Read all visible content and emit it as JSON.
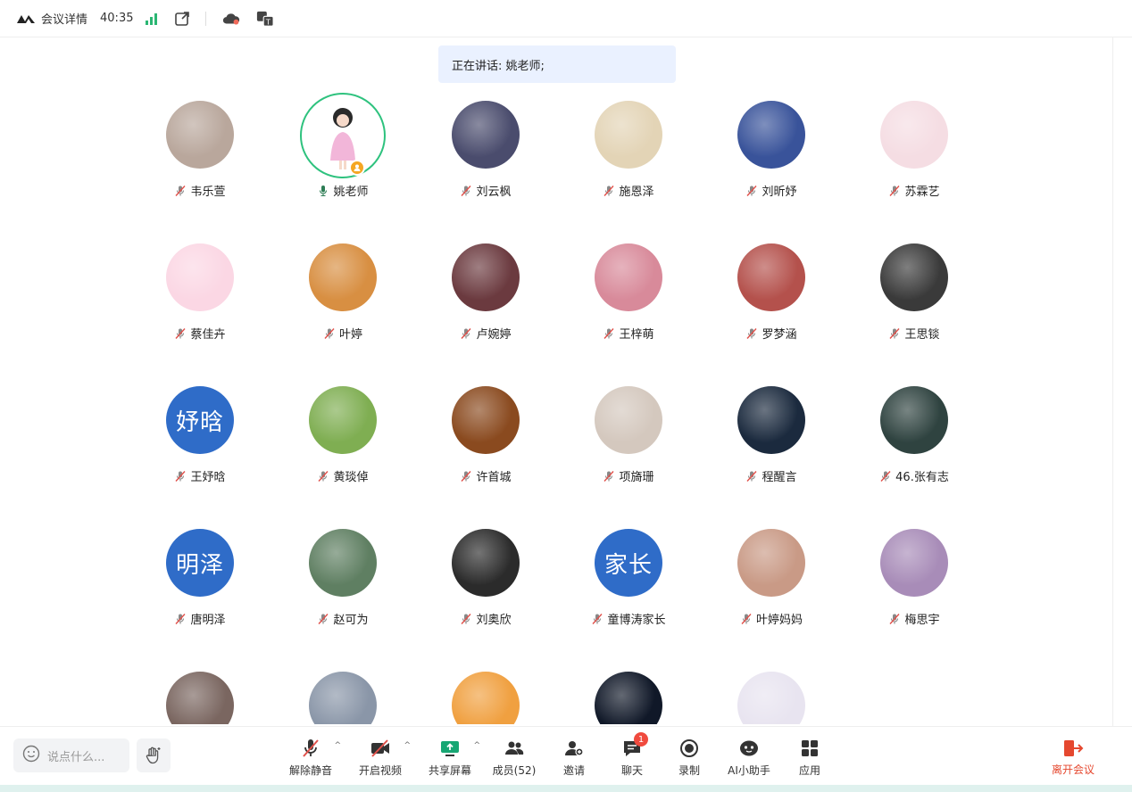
{
  "topbar": {
    "title": "会议详情",
    "timer": "40:35",
    "icons": [
      "logo-icon",
      "signal-icon",
      "external-link-icon",
      "cloud-icon",
      "translate-icon"
    ]
  },
  "speaking": {
    "text": "正在讲话: 姚老师;"
  },
  "colors": {
    "speaker_ring": "#2ec27e",
    "text_avatar_bg": "#2f6cc8",
    "leave_red": "#e5482f",
    "badge_red": "#f04a3e"
  },
  "participants": [
    {
      "name": "韦乐萱",
      "muted": true,
      "avatar": {
        "type": "image",
        "bg": "#b9a79c"
      }
    },
    {
      "name": "姚老师",
      "muted": false,
      "speaking": true,
      "host": true,
      "avatar": {
        "type": "image",
        "bg": "#f6e9f3"
      }
    },
    {
      "name": "刘云枫",
      "muted": true,
      "avatar": {
        "type": "image",
        "bg": "#4a4c6d"
      }
    },
    {
      "name": "施恩泽",
      "muted": true,
      "avatar": {
        "type": "image",
        "bg": "#e3d4b6"
      }
    },
    {
      "name": "刘昕妤",
      "muted": true,
      "avatar": {
        "type": "image",
        "bg": "#39539a"
      }
    },
    {
      "name": "苏霖艺",
      "muted": true,
      "avatar": {
        "type": "image",
        "bg": "#f5dde3"
      }
    },
    {
      "name": "蔡佳卉",
      "muted": true,
      "avatar": {
        "type": "image",
        "bg": "#fbd7e4"
      }
    },
    {
      "name": "叶婷",
      "muted": true,
      "avatar": {
        "type": "image",
        "bg": "#d88f42"
      }
    },
    {
      "name": "卢婉婷",
      "muted": true,
      "avatar": {
        "type": "image",
        "bg": "#6b3a3f"
      }
    },
    {
      "name": "王梓萌",
      "muted": true,
      "avatar": {
        "type": "image",
        "bg": "#d88a9a"
      }
    },
    {
      "name": "罗梦涵",
      "muted": true,
      "avatar": {
        "type": "image",
        "bg": "#b4514c"
      }
    },
    {
      "name": "王思锬",
      "muted": true,
      "avatar": {
        "type": "image",
        "bg": "#3a3a3a"
      }
    },
    {
      "name": "王妤晗",
      "muted": true,
      "avatar": {
        "type": "text",
        "text": "妤晗"
      }
    },
    {
      "name": "黄琰倬",
      "muted": true,
      "avatar": {
        "type": "image",
        "bg": "#7fae52"
      }
    },
    {
      "name": "许首城",
      "muted": true,
      "avatar": {
        "type": "image",
        "bg": "#8a4a1f"
      }
    },
    {
      "name": "项旖珊",
      "muted": true,
      "avatar": {
        "type": "image",
        "bg": "#d4c8be"
      }
    },
    {
      "name": "程醒言",
      "muted": true,
      "avatar": {
        "type": "image",
        "bg": "#1b2a3e"
      }
    },
    {
      "name": "46.张有志",
      "muted": true,
      "avatar": {
        "type": "image",
        "bg": "#2f4340"
      }
    },
    {
      "name": "唐明泽",
      "muted": true,
      "avatar": {
        "type": "text",
        "text": "明泽"
      }
    },
    {
      "name": "赵可为",
      "muted": true,
      "avatar": {
        "type": "image",
        "bg": "#5f7f62"
      }
    },
    {
      "name": "刘奥欣",
      "muted": true,
      "avatar": {
        "type": "image",
        "bg": "#2b2b2b"
      }
    },
    {
      "name": "童博涛家长",
      "muted": true,
      "avatar": {
        "type": "text",
        "text": "家长"
      }
    },
    {
      "name": "叶婷妈妈",
      "muted": true,
      "avatar": {
        "type": "image",
        "bg": "#c99a86"
      }
    },
    {
      "name": "梅思宇",
      "muted": true,
      "avatar": {
        "type": "image",
        "bg": "#a88cb8"
      }
    },
    {
      "name": "",
      "muted": true,
      "avatar": {
        "type": "image",
        "bg": "#7a6660"
      }
    },
    {
      "name": "",
      "muted": true,
      "avatar": {
        "type": "image",
        "bg": "#8a96a8"
      }
    },
    {
      "name": "",
      "muted": true,
      "avatar": {
        "type": "image",
        "bg": "#f0a040"
      }
    },
    {
      "name": "",
      "muted": true,
      "avatar": {
        "type": "image",
        "bg": "#101828"
      }
    },
    {
      "name": "",
      "muted": true,
      "avatar": {
        "type": "image",
        "bg": "#e8e4f0"
      }
    },
    {
      "name": "",
      "muted": true,
      "avatar": {
        "type": "image",
        "bg": "#ffffff"
      }
    }
  ],
  "bottombar": {
    "chat_placeholder": "说点什么...",
    "tools": [
      {
        "label": "解除静音",
        "icon": "mic-muted-icon",
        "caret": true
      },
      {
        "label": "开启视频",
        "icon": "video-off-icon",
        "caret": true
      },
      {
        "label": "共享屏幕",
        "icon": "share-screen-icon",
        "caret": true
      },
      {
        "label": "成员(52)",
        "icon": "members-icon"
      },
      {
        "label": "邀请",
        "icon": "invite-icon"
      },
      {
        "label": "聊天",
        "icon": "chat-icon",
        "badge": "1"
      },
      {
        "label": "录制",
        "icon": "record-icon"
      },
      {
        "label": "AI小助手",
        "icon": "ai-assistant-icon"
      },
      {
        "label": "应用",
        "icon": "apps-icon"
      }
    ],
    "leave_label": "离开会议"
  }
}
